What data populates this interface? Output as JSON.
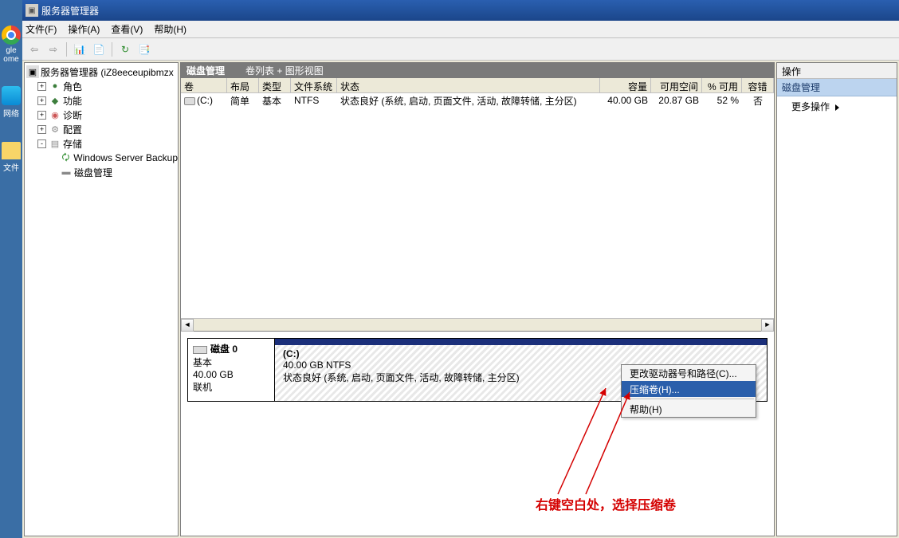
{
  "window": {
    "title": "服务器管理器"
  },
  "menu": {
    "file": "文件(F)",
    "action": "操作(A)",
    "view": "查看(V)",
    "help": "帮助(H)"
  },
  "tree": {
    "root": "服务器管理器 (iZ8eeceupibmzx",
    "roles": "角色",
    "features": "功能",
    "diagnostics": "诊断",
    "config": "配置",
    "storage": "存储",
    "wsb": "Windows Server Backup",
    "diskmgmt": "磁盘管理"
  },
  "mid_header": {
    "title": "磁盘管理",
    "subtitle": "卷列表 + 图形视图"
  },
  "vol_cols": {
    "vol": "卷",
    "layout": "布局",
    "type": "类型",
    "fs": "文件系统",
    "status": "状态",
    "capacity": "容量",
    "free": "可用空间",
    "pct": "% 可用",
    "err": "容错"
  },
  "vol_row": {
    "vol": "(C:)",
    "layout": "简单",
    "type": "基本",
    "fs": "NTFS",
    "status": "状态良好 (系统, 启动, 页面文件, 活动, 故障转储, 主分区)",
    "capacity": "40.00 GB",
    "free": "20.87 GB",
    "pct": "52 %",
    "err": "否"
  },
  "disk": {
    "label": "磁盘 0",
    "type": "基本",
    "size": "40.00 GB",
    "state": "联机",
    "part_name": "(C:)",
    "part_size": "40.00 GB NTFS",
    "part_status": "状态良好 (系统, 启动, 页面文件, 活动, 故障转储, 主分区)"
  },
  "ctx": {
    "change_letter": "更改驱动器号和路径(C)...",
    "shrink": "压缩卷(H)...",
    "help": "帮助(H)"
  },
  "right": {
    "header": "操作",
    "sub": "磁盘管理",
    "more": "更多操作"
  },
  "annotation": "右键空白处，选择压缩卷",
  "desktop": {
    "chrome": "gle",
    "chrome2": "ome",
    "net": "网络",
    "files": "文件"
  }
}
